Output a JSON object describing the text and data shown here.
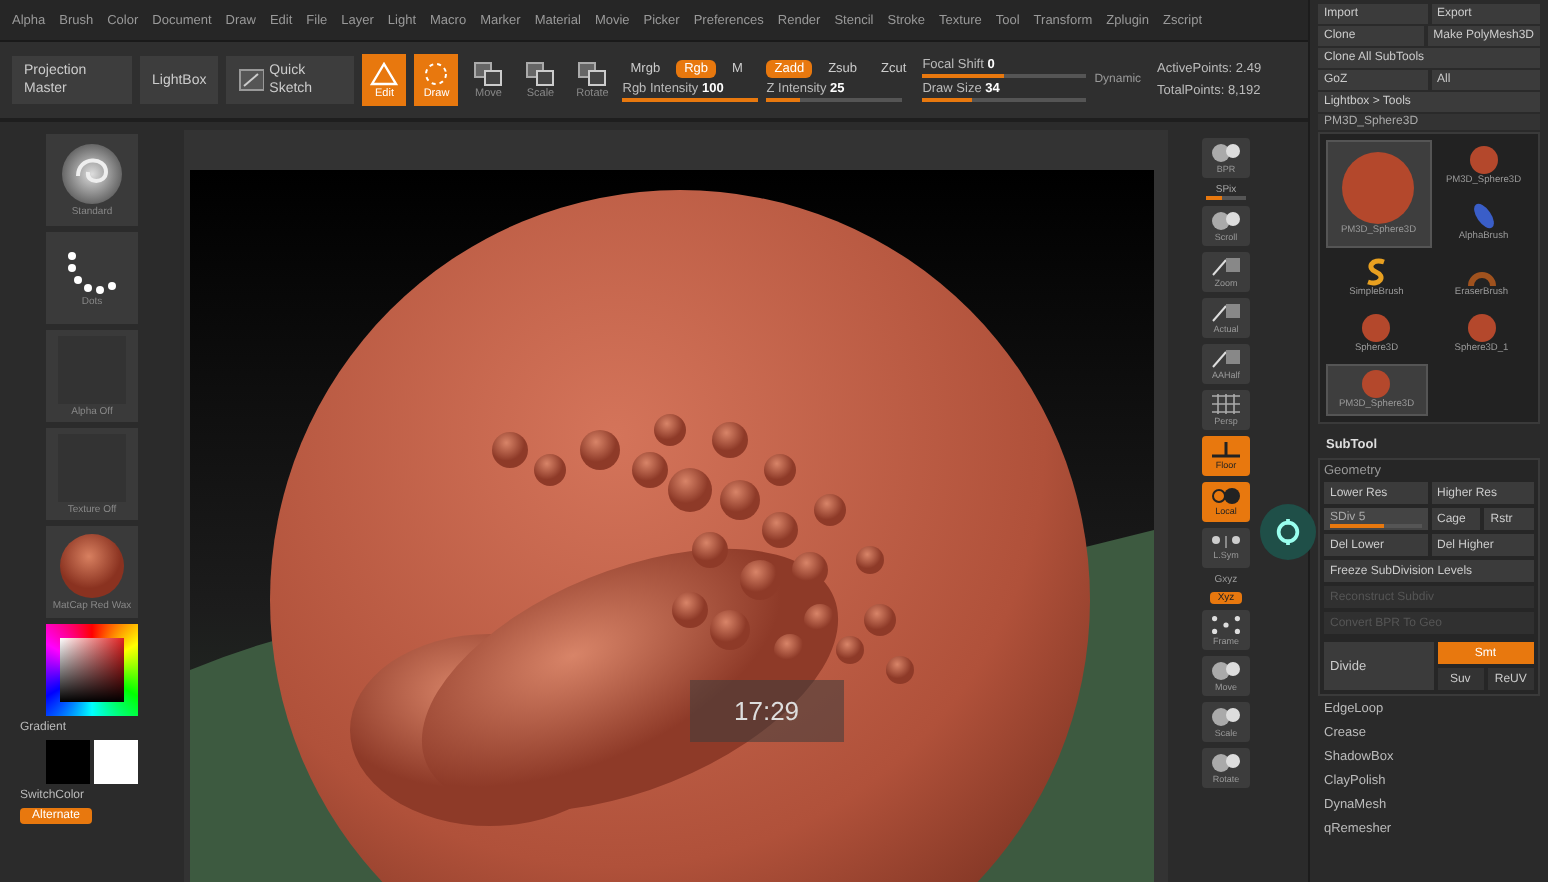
{
  "menu_bar": [
    "Alpha",
    "Brush",
    "Color",
    "Document",
    "Draw",
    "Edit",
    "File",
    "Layer",
    "Light",
    "Macro",
    "Marker",
    "Material",
    "Movie",
    "Picker",
    "Preferences",
    "Render",
    "Stencil",
    "Stroke",
    "Texture",
    "Tool",
    "Transform",
    "Zplugin",
    "Zscript"
  ],
  "toolbar": {
    "left_buttons": [
      "Projection Master",
      "LightBox",
      "Quick Sketch"
    ],
    "modes": [
      {
        "label": "Edit",
        "selected": true
      },
      {
        "label": "Draw",
        "selected": true
      },
      {
        "label": "Move",
        "selected": false
      },
      {
        "label": "Scale",
        "selected": false
      },
      {
        "label": "Rotate",
        "selected": false
      }
    ],
    "groups": [
      {
        "toggles": [
          {
            "label": "Mrgb",
            "on": false
          },
          {
            "label": "Rgb",
            "on": true
          },
          {
            "label": "M",
            "on": false
          }
        ],
        "slider": {
          "label": "Rgb Intensity",
          "value": "100",
          "level": 1
        }
      },
      {
        "toggles": [
          {
            "label": "Zadd",
            "on": true
          },
          {
            "label": "Zsub",
            "on": false
          },
          {
            "label": "Zcut",
            "on": false
          }
        ],
        "slider": {
          "label": "Z Intensity",
          "value": "25",
          "level": 0.25
        }
      }
    ],
    "sliders": [
      {
        "label": "Focal Shift",
        "value": "0",
        "level": 0.5
      },
      {
        "label": "Draw Size",
        "value": "34",
        "level": 0.3
      }
    ],
    "dynamic": "Dynamic",
    "stats": [
      "ActivePoints: 2.49",
      "TotalPoints: 8,192"
    ]
  },
  "left_shelf": [
    "Standard",
    "Dots",
    "Alpha Off",
    "Texture Off",
    "MatCap Red Wax"
  ],
  "color_picker": {
    "gradient_label": "Gradient",
    "switch_label": "SwitchColor",
    "alternate": {
      "label": "Alternate",
      "on": true
    }
  },
  "viewport": {
    "timestamp": "17:29"
  },
  "right_shelf": [
    {
      "kind": "button",
      "label": "BPR",
      "on": false
    },
    {
      "kind": "slider",
      "label": "SPix",
      "level": 0.4
    },
    {
      "kind": "button",
      "label": "Scroll",
      "on": false
    },
    {
      "kind": "button",
      "label": "Zoom",
      "on": false
    },
    {
      "kind": "button",
      "label": "Actual",
      "on": false
    },
    {
      "kind": "button",
      "label": "AAHalf",
      "on": false
    },
    {
      "kind": "button",
      "label": "Persp",
      "on": false
    },
    {
      "kind": "button",
      "label": "Floor",
      "on": true
    },
    {
      "kind": "button",
      "label": "Local",
      "on": true
    },
    {
      "kind": "button",
      "label": "L.Sym",
      "on": false
    },
    {
      "kind": "text",
      "label": "Gxyz"
    },
    {
      "kind": "small",
      "label": "Xyz",
      "on": true
    },
    {
      "kind": "button",
      "label": "Frame",
      "on": false
    },
    {
      "kind": "button",
      "label": "Move",
      "on": false
    },
    {
      "kind": "button",
      "label": "Scale",
      "on": false
    },
    {
      "kind": "button",
      "label": "Rotate",
      "on": false
    }
  ],
  "tool_panel": {
    "top_rows": [
      [
        "Import",
        "Export"
      ],
      [
        "Clone",
        "Make PolyMesh3D"
      ],
      [
        "Clone All SubTools"
      ],
      [
        "GoZ",
        "All"
      ],
      [
        "Lightbox > Tools"
      ]
    ],
    "current_tool": "PM3D_Sphere3D",
    "featured_tool": {
      "name": "PM3D_Sphere3D",
      "selected": true
    },
    "side_tools": [
      {
        "name": "PM3D_Sphere3D",
        "selected": false
      },
      {
        "name": "AlphaBrush",
        "selected": false
      }
    ],
    "tools": [
      {
        "name": "SimpleBrush",
        "selected": false
      },
      {
        "name": "EraserBrush",
        "selected": false
      },
      {
        "name": "Sphere3D",
        "selected": false
      },
      {
        "name": "Sphere3D_1",
        "selected": false
      },
      {
        "name": "PM3D_Sphere3D",
        "selected": true
      }
    ],
    "subtool": "SubTool",
    "geometry": {
      "title": "Geometry",
      "rows": [
        [
          {
            "kind": "button",
            "label": "Lower Res"
          },
          {
            "kind": "button",
            "label": "Higher Res"
          }
        ],
        [
          {
            "kind": "slider",
            "label": "SDiv 5",
            "level": 0.6
          },
          {
            "kind": "pair",
            "items": [
              "Cage",
              "Rstr"
            ]
          }
        ],
        [
          {
            "kind": "button",
            "label": "Del Lower"
          },
          {
            "kind": "button",
            "label": "Del Higher"
          }
        ],
        [
          {
            "kind": "button",
            "label": "Freeze SubDivision Levels"
          }
        ],
        [
          {
            "kind": "disabled",
            "label": "Reconstruct Subdiv"
          }
        ],
        [
          {
            "kind": "disabled",
            "label": "Convert BPR To Geo"
          }
        ]
      ],
      "divide": {
        "label": "Divide",
        "toggles": [
          {
            "label": "Smt",
            "on": true
          },
          {
            "label": "Suv",
            "on": false
          },
          {
            "label": "ReUV",
            "on": false
          }
        ]
      }
    },
    "sections": [
      "EdgeLoop",
      "Crease",
      "ShadowBox",
      "ClayPolish",
      "DynaMesh",
      "qRemesher"
    ]
  }
}
